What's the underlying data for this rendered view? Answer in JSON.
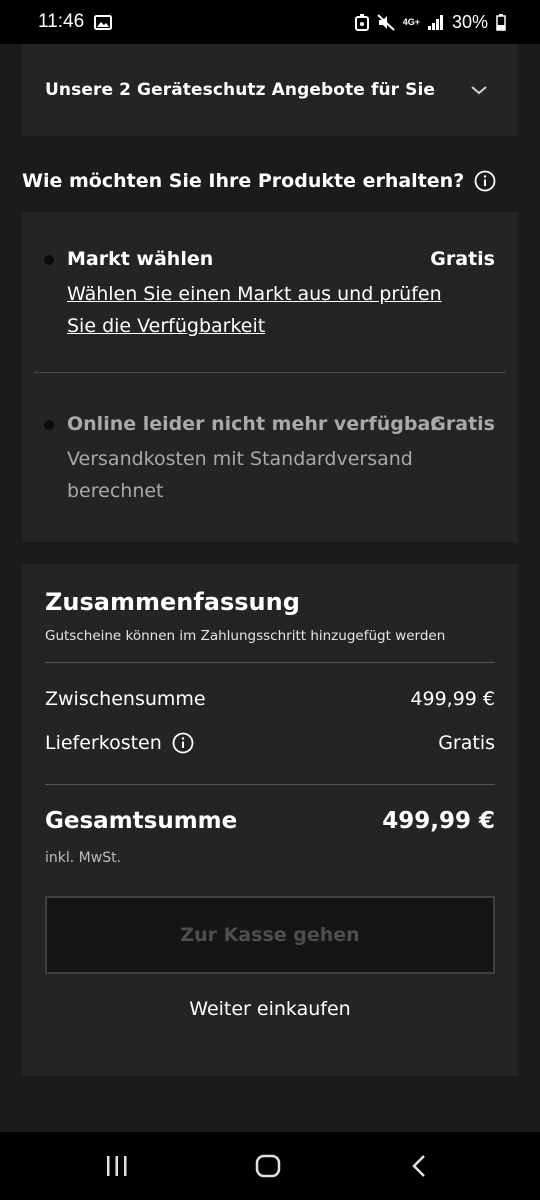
{
  "status_bar": {
    "time": "11:46",
    "network": "4G+",
    "battery": "30%"
  },
  "offers": {
    "title": "Unsere 2 Geräteschutz Angebote für Sie"
  },
  "delivery": {
    "heading": "Wie möchten Sie Ihre Produkte erhalten?",
    "options": [
      {
        "title": "Markt wählen",
        "price": "Gratis",
        "description": "Wählen Sie einen Markt aus und prüfen Sie die Verfügbarkeit",
        "enabled": true
      },
      {
        "title": "Online leider nicht mehr verfügbar",
        "price": "Gratis",
        "description": "Versandkosten mit Standardversand berechnet",
        "enabled": false
      }
    ]
  },
  "summary": {
    "title": "Zusammenfassung",
    "subtitle": "Gutscheine können im Zahlungsschritt hinzugefügt werden",
    "subtotal_label": "Zwischensumme",
    "subtotal_value": "499,99 €",
    "shipping_label": "Lieferkosten",
    "shipping_value": "Gratis",
    "total_label": "Gesamtsumme",
    "total_value": "499,99 €",
    "vat_note": "inkl. MwSt.",
    "checkout_label": "Zur Kasse gehen",
    "continue_label": "Weiter einkaufen"
  },
  "colors": {
    "background": "#1a1b1c",
    "card": "#232425",
    "text": "#ffffff",
    "muted": "#a9a9a9",
    "disabled_button_text": "#4d4e50"
  }
}
